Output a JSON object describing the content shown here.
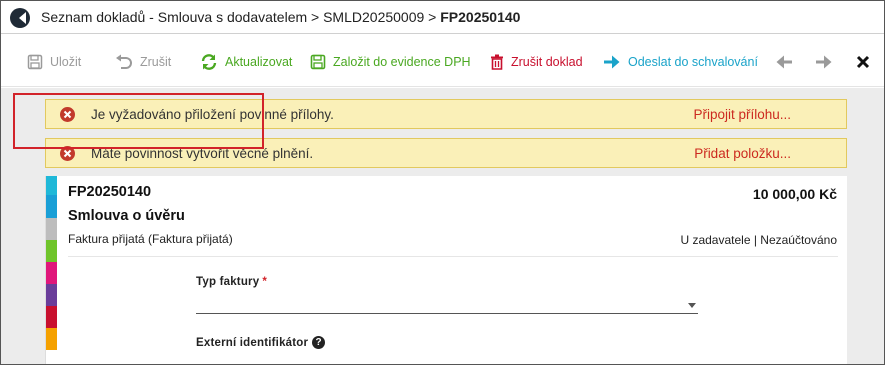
{
  "breadcrumb": {
    "prefix": "Seznam dokladů - Smlouva s dodavatelem > SMLD20250009 > ",
    "current": "FP20250140"
  },
  "toolbar": {
    "save_label": "Uložit",
    "cancel_label": "Zrušit",
    "refresh_label": "Aktualizovat",
    "vat_label": "Založit do evidence DPH",
    "delete_label": "Zrušit doklad",
    "send_label": "Odeslat do schvalování"
  },
  "alerts": [
    {
      "text": "Je vyžadováno přiložení povinné přílohy.",
      "link": "Připojit přílohu..."
    },
    {
      "text": "Máte povinnost vytvořit věcné plnění.",
      "link": "Přidat položku..."
    }
  ],
  "document": {
    "number": "FP20250140",
    "title": "Smlouva o úvěru",
    "type": "Faktura přijatá (Faktura přijatá)",
    "amount": "10 000,00 Kč",
    "status": "U zadavatele | Nezaúčtováno"
  },
  "form": {
    "invoice_type_label": "Typ faktury",
    "required_mark": "*",
    "invoice_type_value": "",
    "external_id_label": "Externí identifikátor",
    "help_glyph": "?"
  },
  "colors": {
    "accent_green": "#4aa821",
    "accent_red": "#c8102e",
    "accent_blue": "#1aa3c9",
    "alert_background": "#faf0b8",
    "highlight_border": "#d2232a",
    "stripes": [
      "#1fb8d8",
      "#1a9fd6",
      "#bdbdbd",
      "#6fc42a",
      "#e0177b",
      "#6a3d9a",
      "#c8102e",
      "#f5a100"
    ]
  },
  "icons": {
    "save": "floppy-icon",
    "cancel": "undo-icon",
    "refresh": "refresh-icon",
    "vat": "floppy-icon",
    "delete": "trash-icon",
    "send": "arrow-right-icon",
    "back": "arrow-left-icon",
    "forward": "arrow-right-icon",
    "close": "close-icon",
    "alert": "error-circle-icon",
    "help": "question-circle-icon"
  }
}
